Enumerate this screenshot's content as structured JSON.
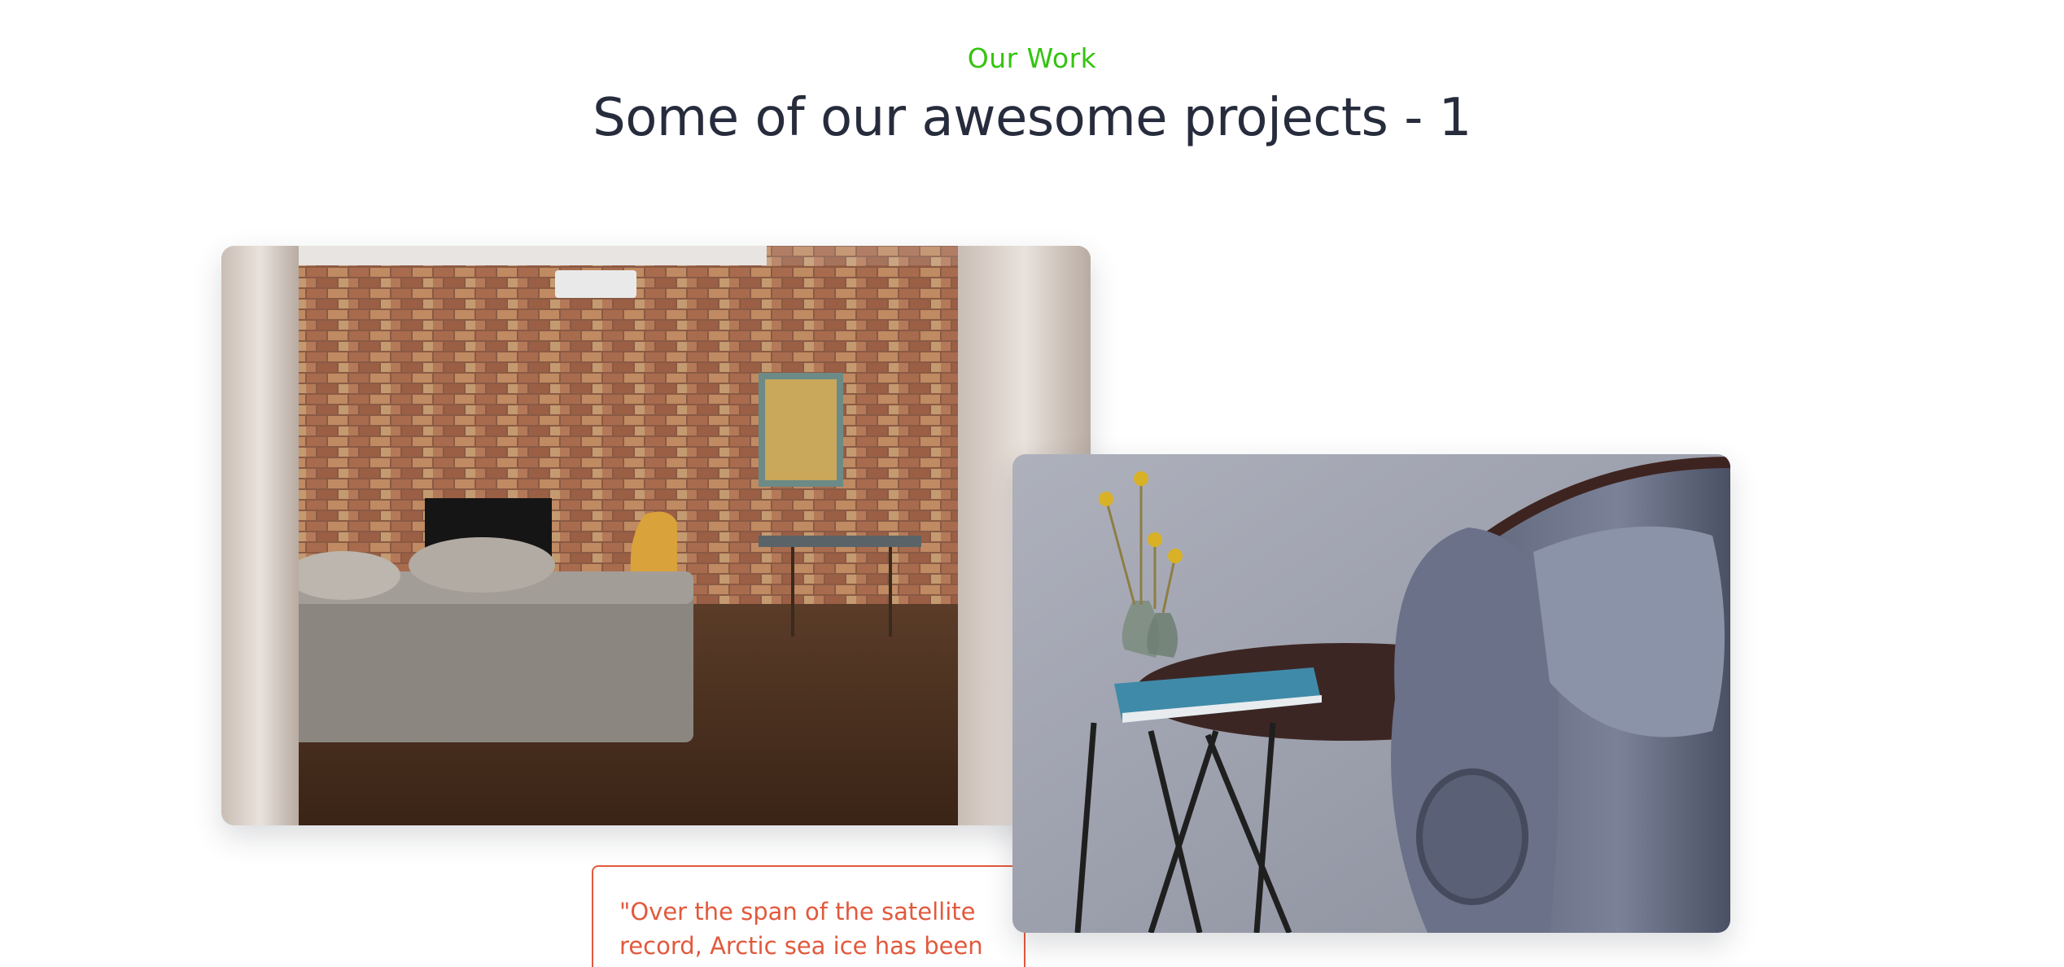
{
  "section": {
    "eyebrow": "Our Work",
    "title": "Some of our awesome projects - 1"
  },
  "images": [
    {
      "name": "living-room-brick-wall-photo"
    },
    {
      "name": "side-table-armchair-photo"
    }
  ],
  "quote": {
    "text": "\"Over the span of the satellite record, Arctic sea ice has been"
  },
  "colors": {
    "accent_green": "#34c40f",
    "heading": "#272c3d",
    "quote_red": "#e2593c",
    "background": "#ffffff"
  }
}
